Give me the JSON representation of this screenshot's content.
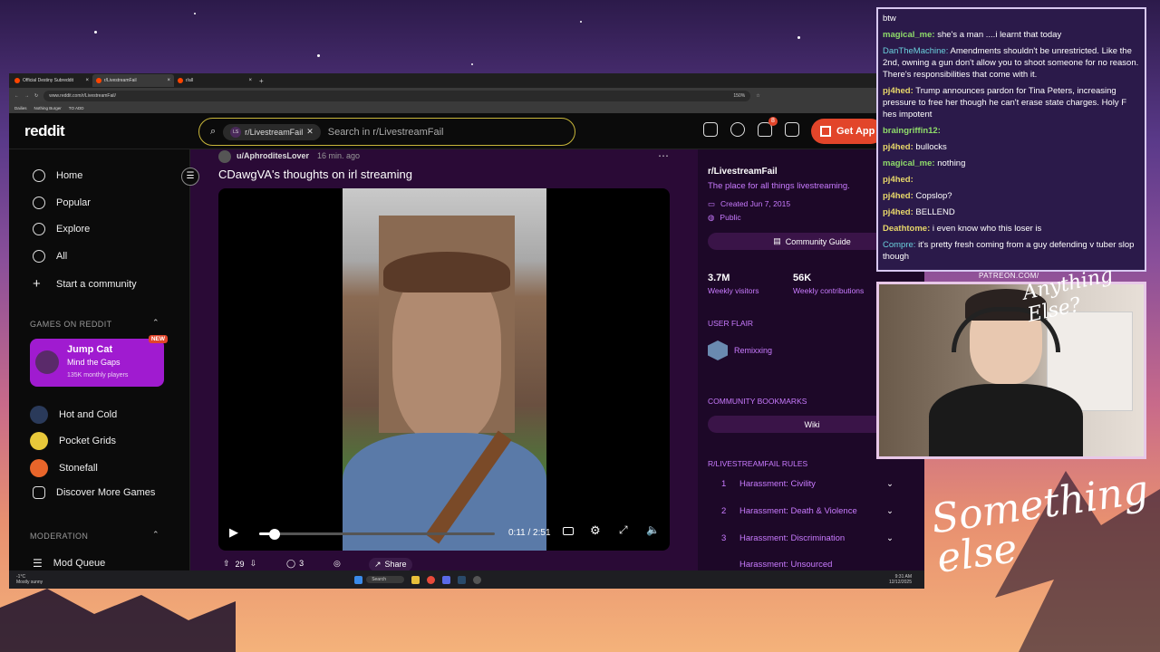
{
  "browser": {
    "tabs": [
      "Official Destiny Subreddit",
      "r/LivestreamFail",
      "r/all"
    ],
    "url": "www.reddit.com/r/LivestreamFail/",
    "zoom": "150%",
    "bookmarks": [
      "Dailies",
      "Nothing Burger",
      "TO ADD"
    ]
  },
  "header": {
    "logo": "reddit",
    "search_chip": "r/LivestreamFail",
    "search_chip_icon": "LS",
    "search_placeholder": "Search in r/LivestreamFail",
    "notif_count": "8",
    "get_app": "Get App"
  },
  "sidebar": {
    "nav": [
      "Home",
      "Popular",
      "Explore",
      "All",
      "Start a community"
    ],
    "games_title": "GAMES ON REDDIT",
    "featured_game": {
      "name": "Jump Cat",
      "subtitle": "Mind the Gaps",
      "players": "135K monthly players",
      "badge": "NEW"
    },
    "games": [
      "Hot and Cold",
      "Pocket Grids",
      "Stonefall",
      "Discover More Games"
    ],
    "moderation_title": "MODERATION",
    "mod_item": "Mod Queue"
  },
  "post": {
    "author": "u/AphroditesLover",
    "time": "16 min. ago",
    "title": "CDawgVA's thoughts on irl streaming",
    "video_time": "0:11 / 2:51",
    "progress": 0.064,
    "upvotes": "29",
    "comments": "3",
    "share": "Share"
  },
  "community": {
    "name": "r/LivestreamFail",
    "tagline": "The place for all things livestreaming.",
    "created": "Created Jun 7, 2015",
    "visibility": "Public",
    "guide_button": "Community Guide",
    "visitors": "3.7M",
    "visitors_label": "Weekly visitors",
    "contributions": "56K",
    "contributions_label": "Weekly contributions",
    "user_flair_title": "USER FLAIR",
    "user_flair": "Remixxing",
    "bookmarks_title": "COMMUNITY BOOKMARKS",
    "wiki": "Wiki",
    "rules_title": "R/LIVESTREAMFAIL RULES",
    "rules": [
      {
        "num": "1",
        "text": "Harassment: Civility"
      },
      {
        "num": "2",
        "text": "Harassment: Death & Violence"
      },
      {
        "num": "3",
        "text": "Harassment: Discrimination"
      },
      {
        "num": "",
        "text": "Harassment: Unsourced"
      }
    ]
  },
  "taskbar": {
    "weather": "-1°C",
    "weather_desc": "Mostly sunny",
    "search": "Search",
    "time": "9:31 AM",
    "date": "12/12/2025"
  },
  "chat": {
    "messages": [
      {
        "user": "",
        "text": "btw",
        "color": "plain"
      },
      {
        "user": "magical_me:",
        "text": "she's a man ....i learnt that today",
        "color": "green"
      },
      {
        "user": "DanTheMachine:",
        "text": "Amendments shouldn't be unrestricted. Like the 2nd, owning a gun don't allow you to shoot someone for no reason. There's responsibilities that come with it.",
        "color": "cyan"
      },
      {
        "user": "pj4hed:",
        "text": "Trump announces pardon for Tina Peters, increasing pressure to free her though he can't erase state charges. Holy F hes impotent",
        "color": "yellow"
      },
      {
        "user": "braingriffin12:",
        "text": "",
        "color": "green"
      },
      {
        "user": "pj4hed:",
        "text": "bullocks",
        "color": "yellow"
      },
      {
        "user": "magical_me:",
        "text": "nothing",
        "color": "green"
      },
      {
        "user": "pj4hed:",
        "text": "",
        "color": "yellow"
      },
      {
        "user": "pj4hed:",
        "text": "Copslop?",
        "color": "yellow"
      },
      {
        "user": "pj4hed:",
        "text": "BELLEND",
        "color": "yellow"
      },
      {
        "user": "Deathtome:",
        "text": "i even know who this loser is",
        "color": "yellow"
      },
      {
        "user": "Compre:",
        "text": "it's pretty fresh coming from a guy defending v tuber slop though",
        "color": "cyan"
      }
    ]
  },
  "overlay": {
    "patreon": "PATREON.COM/",
    "brand_small": "Anything Else?",
    "brand_large": "Something else"
  },
  "colors": {
    "accent": "#a01bd0",
    "get_app": "#e2452a",
    "link": "#c97bff",
    "post_bg": "#2a0a36"
  }
}
